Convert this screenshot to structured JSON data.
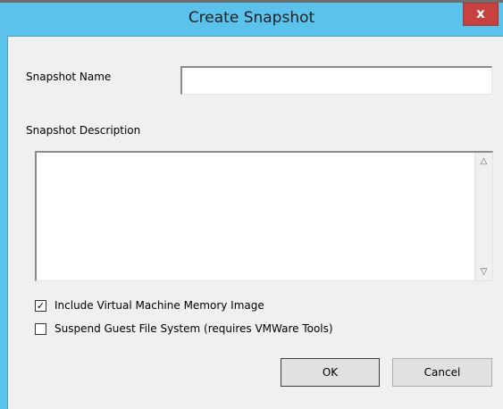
{
  "window": {
    "title": "Create Snapshot",
    "close_glyph": "x"
  },
  "form": {
    "name_label": "Snapshot Name",
    "name_value": "",
    "description_label": "Snapshot Description",
    "description_value": ""
  },
  "options": [
    {
      "label": "Include Virtual Machine Memory Image",
      "checked": true
    },
    {
      "label": "Suspend Guest File System (requires VMWare Tools)",
      "checked": false
    }
  ],
  "buttons": {
    "ok_label": "OK",
    "cancel_label": "Cancel"
  },
  "colors": {
    "titlebar": "#5bc3eb",
    "close_button": "#c74141",
    "client_background": "#f0f0f0"
  }
}
